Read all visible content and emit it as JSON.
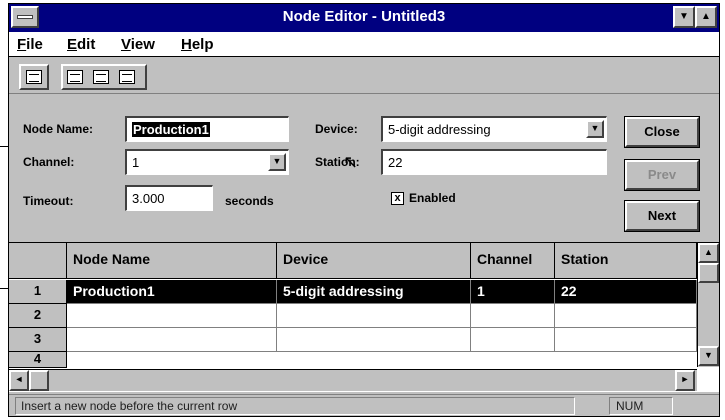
{
  "window": {
    "title": "Node Editor - Untitled3"
  },
  "menu": {
    "file": {
      "u": "F",
      "rest": "ile"
    },
    "edit": {
      "u": "E",
      "rest": "dit"
    },
    "view": {
      "u": "V",
      "rest": "iew"
    },
    "help": {
      "u": "H",
      "rest": "elp"
    }
  },
  "toolbar": {
    "icons": [
      "properties-icon",
      "insert-row-icon",
      "delete-row-icon",
      "append-row-icon"
    ]
  },
  "form": {
    "node_name_label": "Node Name:",
    "node_name_value": "Production1",
    "channel_label": "Channel:",
    "channel_value": "1",
    "timeout_label": "Timeout:",
    "timeout_value": "3.000",
    "timeout_unit": "seconds",
    "device_label": "Device:",
    "device_value": "5-digit addressing",
    "station_label": "Station:",
    "station_value": "22",
    "enabled_label": "Enabled",
    "enabled_mark": "x",
    "close_label": "Close",
    "prev_label": "Prev",
    "next_label": "Next"
  },
  "grid": {
    "columns": [
      "Node Name",
      "Device",
      "Channel",
      "Station"
    ],
    "row_numbers": [
      "1",
      "2",
      "3",
      "4"
    ],
    "rows": [
      {
        "node_name": "Production1",
        "device": "5-digit addressing",
        "channel": "1",
        "station": "22"
      },
      {
        "node_name": "",
        "device": "",
        "channel": "",
        "station": ""
      },
      {
        "node_name": "",
        "device": "",
        "channel": "",
        "station": ""
      }
    ]
  },
  "status": {
    "message": "Insert a new node before the current row",
    "indicator": "NUM"
  },
  "colors": {
    "titlebar": "#000080",
    "face": "#c0c0c0",
    "selection": "#000000"
  }
}
